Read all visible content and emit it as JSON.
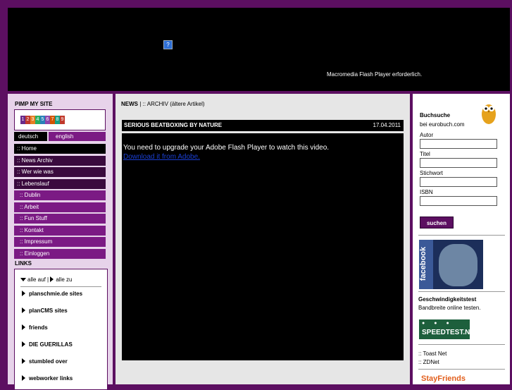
{
  "header": {
    "flash_icon": "?",
    "flash_notice": "Macromedia Flash Player erforderlich."
  },
  "left": {
    "pimp_title": "PIMP MY SITE",
    "logo_digits": [
      "1",
      "2",
      "3",
      "4",
      "5",
      "6",
      "7",
      "8",
      "9"
    ],
    "lang": {
      "de": "deutsch",
      "en": "english"
    },
    "menu": [
      {
        "label": ":: Home",
        "active": true
      },
      {
        "label": "::  News Archiv"
      },
      {
        "label": "::  Wer wie was"
      },
      {
        "label": "::  Lebenslauf"
      },
      {
        "label": ":: Dublin",
        "sub": true
      },
      {
        "label": ":: Arbeit",
        "sub": true
      },
      {
        "label": ":: Fun Stuff",
        "sub": true
      },
      {
        "label": ":: Kontakt",
        "sub": true
      },
      {
        "label": ":: Impressum",
        "sub": true
      },
      {
        "label": ":: Einloggen",
        "sub": true
      }
    ],
    "links_title": "LINKS",
    "links_controls": {
      "open_all": "alle auf",
      "sep": " | ",
      "close_all": "alle zu"
    },
    "links": [
      "planschmie.de sites",
      "planCMS sites",
      "friends",
      "DIE GUERILLAS",
      "stumbled over",
      "webworker links"
    ]
  },
  "main": {
    "breadcrumb_bold": "NEWS",
    "breadcrumb_rest": " | :: ARCHIV (ältere Artikel)",
    "article_title": "SERIOUS BEATBOXING BY NATURE",
    "article_date": "17.04.2011",
    "video_message": "You need to upgrade your Adobe Flash Player to watch this video.",
    "video_link": "Download it from Adobe."
  },
  "right": {
    "book_title": "Buchsuche",
    "book_sub": "bei eurobuch.com",
    "fields": [
      "Autor",
      "Titel",
      "Stichwort",
      "ISBN"
    ],
    "search_btn": "suchen",
    "facebook": "facebook",
    "speed_title": "Geschwindigkeitstest",
    "speed_sub": "Bandbreite online testen.",
    "speed_logo": "SPEEDTEST.NET",
    "links": [
      ":: Toast Net",
      ":: ZDNet"
    ],
    "stayfriends": "StayFriends"
  },
  "colors": {
    "purple": "#5c0f61",
    "menu_purple": "#7b1a84",
    "dark_purple": "#3a0a3e"
  }
}
